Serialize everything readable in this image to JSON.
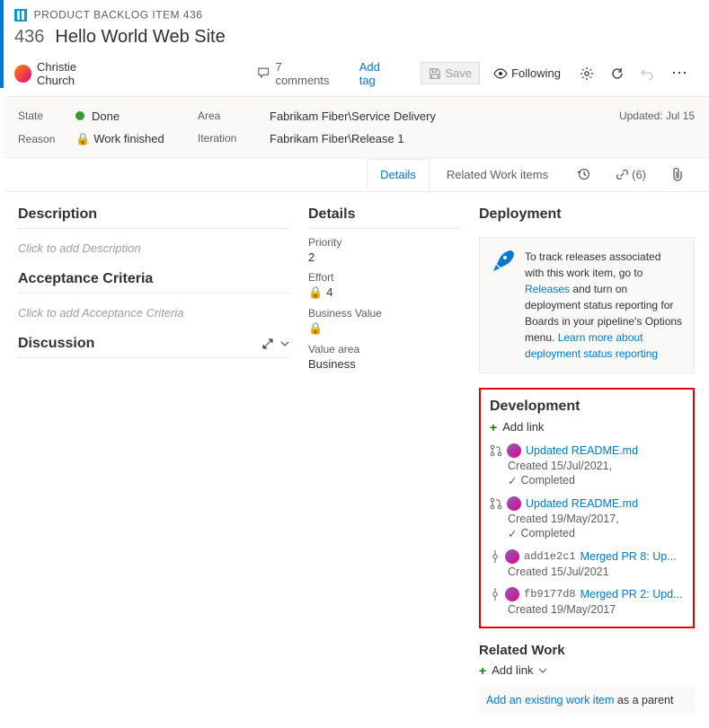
{
  "header": {
    "type_label": "PRODUCT BACKLOG ITEM 436",
    "id": "436",
    "title": "Hello World Web Site",
    "assignee": "Christie Church",
    "comments_count": "7 comments",
    "add_tag": "Add tag"
  },
  "toolbar": {
    "save": "Save",
    "following": "Following"
  },
  "fields": {
    "state_label": "State",
    "state_value": "Done",
    "reason_label": "Reason",
    "reason_value": "Work finished",
    "area_label": "Area",
    "area_value": "Fabrikam Fiber\\Service Delivery",
    "iteration_label": "Iteration",
    "iteration_value": "Fabrikam Fiber\\Release 1",
    "updated": "Updated: Jul 15"
  },
  "tabs": {
    "details": "Details",
    "related": "Related Work items",
    "links_count": "(6)"
  },
  "left": {
    "description_h": "Description",
    "description_ph": "Click to add Description",
    "acceptance_h": "Acceptance Criteria",
    "acceptance_ph": "Click to add Acceptance Criteria",
    "discussion_h": "Discussion"
  },
  "mid": {
    "details_h": "Details",
    "priority_l": "Priority",
    "priority_v": "2",
    "effort_l": "Effort",
    "effort_v": "4",
    "bv_l": "Business Value",
    "va_l": "Value area",
    "va_v": "Business"
  },
  "right": {
    "deployment_h": "Deployment",
    "deploy_text1": "To track releases associated with this work item, go to ",
    "deploy_link1": "Releases",
    "deploy_text2": " and turn on deployment status reporting for Boards in your pipeline's Options menu. ",
    "deploy_link2": "Learn more about deployment status reporting",
    "development_h": "Development",
    "add_link": "Add link",
    "items": [
      {
        "icon": "pr",
        "title": "Updated README.md",
        "sub": "Created 15/Jul/2021,",
        "status": "Completed"
      },
      {
        "icon": "pr",
        "title": "Updated README.md",
        "sub": "Created 19/May/2017,",
        "status": "Completed"
      },
      {
        "icon": "commit",
        "hash": "add1e2c1",
        "title": "Merged PR 8: Up...",
        "sub": "Created 15/Jul/2021"
      },
      {
        "icon": "commit",
        "hash": "fb9177d8",
        "title": "Merged PR 2: Upd...",
        "sub": "Created 19/May/2017"
      }
    ],
    "related_h": "Related Work",
    "add_link2": "Add link",
    "existing_link": "Add an existing work item",
    "existing_text": " as a parent"
  }
}
